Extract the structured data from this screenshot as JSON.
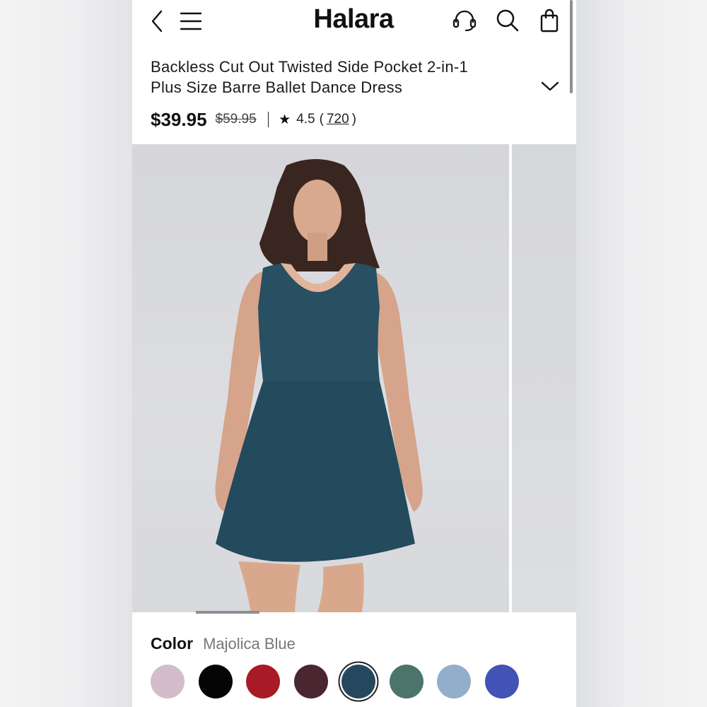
{
  "header": {
    "brand": "Halara",
    "back_icon": "chevron-left-icon",
    "menu_icon": "hamburger-menu-icon",
    "support_icon": "headset-icon",
    "search_icon": "search-icon",
    "bag_icon": "shopping-bag-icon"
  },
  "product": {
    "title_line1": "Backless Cut Out Twisted Side Pocket 2-in-1",
    "title_line2": "Plus Size Barre Ballet Dance Dress",
    "price": "$39.95",
    "original_price": "$59.95",
    "rating": "4.5",
    "paren_open": "(",
    "review_count": "720",
    "paren_close": ")"
  },
  "gallery": {
    "image_description": "model wearing dress",
    "current_index_fraction": 0.15
  },
  "color": {
    "label": "Color",
    "selected": "Majolica Blue",
    "swatches": [
      {
        "hex": "#d3bccb"
      },
      {
        "hex": "#050505"
      },
      {
        "hex": "#a81a26"
      },
      {
        "hex": "#4a2630"
      },
      {
        "hex": "#26485f",
        "selected": true
      },
      {
        "hex": "#4b756b"
      },
      {
        "hex": "#93aecb"
      },
      {
        "hex": "#4352b5"
      }
    ]
  }
}
